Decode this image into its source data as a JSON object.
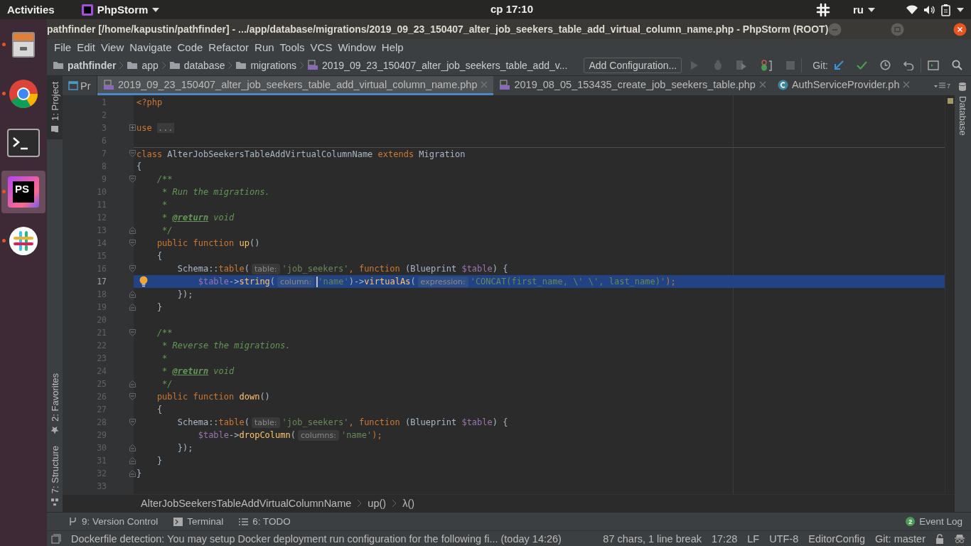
{
  "top_bar": {
    "activities": "Activities",
    "app_menu": "PhpStorm",
    "clock": "ср 17:10",
    "keyboard_layout": "ru"
  },
  "dock": [
    {
      "kind": "files",
      "running": true,
      "selected": false
    },
    {
      "kind": "browser",
      "running": true,
      "selected": false
    },
    {
      "kind": "terminal",
      "running": false,
      "selected": false
    },
    {
      "kind": "ide",
      "running": true,
      "selected": true,
      "logo": "PS"
    },
    {
      "kind": "chat",
      "running": true,
      "selected": false
    }
  ],
  "window": {
    "title": "pathfinder [/home/kapustin/pathfinder] - .../app/database/migrations/2019_09_23_150407_alter_job_seekers_table_add_virtual_column_name.php - PhpStorm (ROOT)"
  },
  "menu": [
    "File",
    "Edit",
    "View",
    "Navigate",
    "Code",
    "Refactor",
    "Run",
    "Tools",
    "VCS",
    "Window",
    "Help"
  ],
  "navigation": {
    "path": [
      {
        "label": "pathfinder",
        "kind": "project"
      },
      {
        "label": "app",
        "kind": "folder"
      },
      {
        "label": "database",
        "kind": "folder"
      },
      {
        "label": "migrations",
        "kind": "folder"
      },
      {
        "label": "2019_09_23_150407_alter_job_seekers_table_add_v...",
        "kind": "php"
      }
    ],
    "run_config": "Add Configuration...",
    "git_label": "Git:"
  },
  "left_tool_windows": [
    {
      "label": "1: Project",
      "kind": "project",
      "selected": true
    },
    {
      "label": "2: Favorites",
      "kind": "favorites",
      "selected": false
    },
    {
      "label": "7: Structure",
      "kind": "structure",
      "selected": false
    }
  ],
  "right_tool_windows": [
    {
      "label": "Database",
      "kind": "database",
      "selected": false
    }
  ],
  "project_tab": {
    "label": "Pr"
  },
  "tabs": [
    {
      "label": "2019_09_23_150407_alter_job_seekers_table_add_virtual_column_name.php",
      "kind": "php",
      "selected": true
    },
    {
      "label": "2019_08_05_153435_create_job_seekers_table.php",
      "kind": "php",
      "selected": false
    },
    {
      "label": "AuthServiceProvider.ph",
      "kind": "class",
      "selected": false
    }
  ],
  "tab_list_count": "7",
  "editor": {
    "lines": [
      {
        "n": "1",
        "selected": false,
        "bulb": false,
        "separator": false,
        "tokens": [
          {
            "kind": "kw",
            "t": "<?php"
          }
        ]
      },
      {
        "n": "2",
        "selected": false,
        "bulb": false,
        "separator": false
      },
      {
        "n": "3",
        "selected": false,
        "bulb": false,
        "separator": false,
        "fold": {
          "kind": "collapsed"
        },
        "tokens": [
          {
            "kind": "kw",
            "t": "use "
          },
          {
            "kind": "folded",
            "t": "..."
          }
        ]
      },
      {
        "n": "6",
        "selected": false,
        "bulb": false,
        "separator": false
      },
      {
        "n": "7",
        "selected": false,
        "bulb": false,
        "separator": true,
        "fold": {
          "kind": "open"
        },
        "tokens": [
          {
            "kind": "kw",
            "t": "class"
          },
          {
            "kind": "plain",
            "t": " AlterJobSeekersTableAddVirtualColumnName "
          },
          {
            "kind": "kw",
            "t": "extends"
          },
          {
            "kind": "plain",
            "t": " Migration"
          }
        ]
      },
      {
        "n": "8",
        "selected": false,
        "bulb": false,
        "separator": false,
        "tokens": [
          {
            "kind": "plain",
            "t": "{"
          }
        ]
      },
      {
        "n": "9",
        "selected": false,
        "bulb": false,
        "separator": false,
        "fold": {
          "kind": "open"
        },
        "tokens": [
          {
            "kind": "comment",
            "t": "    /**"
          }
        ]
      },
      {
        "n": "10",
        "selected": false,
        "bulb": false,
        "separator": false,
        "tokens": [
          {
            "kind": "comment",
            "t": "     * Run the migrations."
          }
        ]
      },
      {
        "n": "11",
        "selected": false,
        "bulb": false,
        "separator": false,
        "tokens": [
          {
            "kind": "comment",
            "t": "     *"
          }
        ]
      },
      {
        "n": "12",
        "selected": false,
        "bulb": false,
        "separator": false,
        "tokens": [
          {
            "kind": "comment",
            "t": "     * "
          },
          {
            "kind": "doctag",
            "t": "@return"
          },
          {
            "kind": "comment",
            "t": " void"
          }
        ]
      },
      {
        "n": "13",
        "selected": false,
        "bulb": false,
        "separator": false,
        "fold": {
          "kind": "close"
        },
        "tokens": [
          {
            "kind": "comment",
            "t": "     */"
          }
        ]
      },
      {
        "n": "14",
        "selected": false,
        "bulb": false,
        "separator": false,
        "fold": {
          "kind": "open"
        },
        "tokens": [
          {
            "kind": "kw",
            "t": "    public function "
          },
          {
            "kind": "fn",
            "t": "up"
          },
          {
            "kind": "plain",
            "t": "()"
          }
        ]
      },
      {
        "n": "15",
        "selected": false,
        "bulb": false,
        "separator": false,
        "tokens": [
          {
            "kind": "plain",
            "t": "    {"
          }
        ]
      },
      {
        "n": "16",
        "selected": false,
        "bulb": false,
        "separator": false,
        "fold": {
          "kind": "open"
        },
        "tokens": [
          {
            "kind": "plain",
            "t": "        Schema::"
          },
          {
            "kind": "kw",
            "t": "table"
          },
          {
            "kind": "plain",
            "t": "("
          },
          {
            "kind": "hint",
            "t": "table:"
          },
          {
            "kind": "str",
            "t": "'job_seekers'"
          },
          {
            "kind": "kw",
            "t": ", function "
          },
          {
            "kind": "plain",
            "t": "(Blueprint "
          },
          {
            "kind": "var",
            "t": "$table"
          },
          {
            "kind": "plain",
            "t": ") {"
          }
        ]
      },
      {
        "n": "17",
        "selected": true,
        "bulb": true,
        "separator": false,
        "tokens": [
          {
            "kind": "var",
            "t": "            $table"
          },
          {
            "kind": "plain",
            "t": "->"
          },
          {
            "kind": "fn",
            "t": "string"
          },
          {
            "kind": "plain",
            "t": "("
          },
          {
            "kind": "hint",
            "t": "column:"
          },
          {
            "kind": "caret"
          },
          {
            "kind": "str",
            "t": "'name'"
          },
          {
            "kind": "plain",
            "t": ")->"
          },
          {
            "kind": "fn",
            "t": "virtualAs"
          },
          {
            "kind": "plain",
            "t": "("
          },
          {
            "kind": "hint",
            "t": "expression:"
          },
          {
            "kind": "str",
            "t": "'CONCAT(first_name, \\' \\', last_name)'"
          },
          {
            "kind": "kw",
            "t": ");"
          }
        ]
      },
      {
        "n": "18",
        "selected": false,
        "bulb": false,
        "separator": false,
        "fold": {
          "kind": "close"
        },
        "tokens": [
          {
            "kind": "plain",
            "t": "        });"
          }
        ]
      },
      {
        "n": "19",
        "selected": false,
        "bulb": false,
        "separator": false,
        "fold": {
          "kind": "close"
        },
        "tokens": [
          {
            "kind": "plain",
            "t": "    }"
          }
        ]
      },
      {
        "n": "20",
        "selected": false,
        "bulb": false,
        "separator": false
      },
      {
        "n": "21",
        "selected": false,
        "bulb": false,
        "separator": false,
        "fold": {
          "kind": "open"
        },
        "tokens": [
          {
            "kind": "comment",
            "t": "    /**"
          }
        ]
      },
      {
        "n": "22",
        "selected": false,
        "bulb": false,
        "separator": false,
        "tokens": [
          {
            "kind": "comment",
            "t": "     * Reverse the migrations."
          }
        ]
      },
      {
        "n": "23",
        "selected": false,
        "bulb": false,
        "separator": false,
        "tokens": [
          {
            "kind": "comment",
            "t": "     *"
          }
        ]
      },
      {
        "n": "24",
        "selected": false,
        "bulb": false,
        "separator": false,
        "tokens": [
          {
            "kind": "comment",
            "t": "     * "
          },
          {
            "kind": "doctag",
            "t": "@return"
          },
          {
            "kind": "comment",
            "t": " void"
          }
        ]
      },
      {
        "n": "25",
        "selected": false,
        "bulb": false,
        "separator": false,
        "fold": {
          "kind": "close"
        },
        "tokens": [
          {
            "kind": "comment",
            "t": "     */"
          }
        ]
      },
      {
        "n": "26",
        "selected": false,
        "bulb": false,
        "separator": false,
        "fold": {
          "kind": "open"
        },
        "tokens": [
          {
            "kind": "kw",
            "t": "    public function "
          },
          {
            "kind": "fn",
            "t": "down"
          },
          {
            "kind": "plain",
            "t": "()"
          }
        ]
      },
      {
        "n": "27",
        "selected": false,
        "bulb": false,
        "separator": false,
        "tokens": [
          {
            "kind": "plain",
            "t": "    {"
          }
        ]
      },
      {
        "n": "28",
        "selected": false,
        "bulb": false,
        "separator": false,
        "fold": {
          "kind": "open"
        },
        "tokens": [
          {
            "kind": "plain",
            "t": "        Schema::"
          },
          {
            "kind": "kw",
            "t": "table"
          },
          {
            "kind": "plain",
            "t": "("
          },
          {
            "kind": "hint",
            "t": "table:"
          },
          {
            "kind": "str",
            "t": "'job_seekers'"
          },
          {
            "kind": "kw",
            "t": ", function "
          },
          {
            "kind": "plain",
            "t": "(Blueprint "
          },
          {
            "kind": "var",
            "t": "$table"
          },
          {
            "kind": "plain",
            "t": ") {"
          }
        ]
      },
      {
        "n": "29",
        "selected": false,
        "bulb": false,
        "separator": false,
        "tokens": [
          {
            "kind": "var",
            "t": "            $table"
          },
          {
            "kind": "plain",
            "t": "->"
          },
          {
            "kind": "fn",
            "t": "dropColumn"
          },
          {
            "kind": "plain",
            "t": "("
          },
          {
            "kind": "hint",
            "t": "columns:"
          },
          {
            "kind": "str",
            "t": "'name'"
          },
          {
            "kind": "kw",
            "t": ");"
          }
        ]
      },
      {
        "n": "30",
        "selected": false,
        "bulb": false,
        "separator": false,
        "fold": {
          "kind": "close"
        },
        "tokens": [
          {
            "kind": "plain",
            "t": "        });"
          }
        ]
      },
      {
        "n": "31",
        "selected": false,
        "bulb": false,
        "separator": false,
        "fold": {
          "kind": "close"
        },
        "tokens": [
          {
            "kind": "plain",
            "t": "    }"
          }
        ]
      },
      {
        "n": "32",
        "selected": false,
        "bulb": false,
        "separator": false,
        "fold": {
          "kind": "close"
        },
        "tokens": [
          {
            "kind": "plain",
            "t": "}"
          }
        ]
      },
      {
        "n": "33",
        "selected": false,
        "bulb": false,
        "separator": false
      }
    ]
  },
  "breadcrumbs": [
    "AlterJobSeekersTableAddVirtualColumnName",
    "up()",
    "λ()"
  ],
  "tool_windows_bar": [
    {
      "label": "9: Version Control",
      "kind": "vcs"
    },
    {
      "label": "Terminal",
      "kind": "terminal"
    },
    {
      "label": "6: TODO",
      "kind": "todo"
    }
  ],
  "event_log": {
    "label": "Event Log",
    "count": "2"
  },
  "status_bar": {
    "message": "Dockerfile detection: You may setup Docker deployment run configuration for the following fi... (today 14:26)",
    "items": [
      "87 chars, 1 line break",
      "17:28",
      "LF",
      "UTF-8",
      "EditorConfig",
      "Git: master"
    ]
  }
}
